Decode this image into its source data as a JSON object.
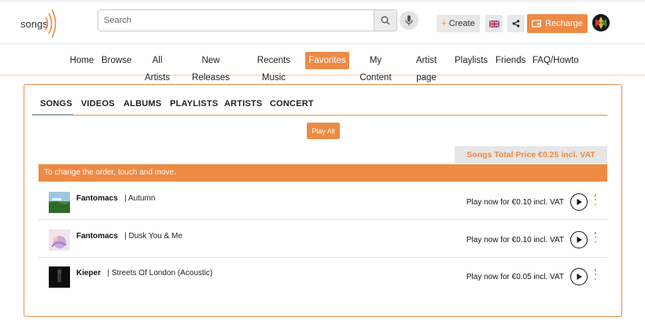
{
  "header": {
    "logo_text": "songs",
    "search": {
      "placeholder": "Search",
      "value": ""
    },
    "create_label": "Create",
    "recharge_label": "Recharge"
  },
  "nav": {
    "items": [
      {
        "label": "Home",
        "active": false
      },
      {
        "label": "Browse",
        "active": false
      },
      {
        "label": "All Artists",
        "active": false
      },
      {
        "label": "New Releases",
        "active": false
      },
      {
        "label": "Recents Music",
        "active": false
      },
      {
        "label": "Favorites",
        "active": true
      },
      {
        "label": "My Content",
        "active": false
      },
      {
        "label": "Artist page",
        "active": false
      },
      {
        "label": "Playlists",
        "active": false
      },
      {
        "label": "Friends",
        "active": false
      },
      {
        "label": "FAQ/Howto",
        "active": false
      }
    ]
  },
  "tabs": [
    {
      "label": "SONGS",
      "active": true
    },
    {
      "label": "VIDEOS",
      "active": false
    },
    {
      "label": "ALBUMS",
      "active": false
    },
    {
      "label": "PLAYLISTS",
      "active": false
    },
    {
      "label": "ARTISTS",
      "active": false
    },
    {
      "label": "CONCERT",
      "active": false
    }
  ],
  "play_all_label": "Play All",
  "total_price_label": "Songs Total Price €0.25 incl. VAT",
  "hint_text": "To change the order, touch and move.",
  "songs": [
    {
      "artist": "Fantomacs",
      "title": "| Autumn",
      "price": "Play now for €0.10 incl. VAT"
    },
    {
      "artist": "Fantomacs",
      "title": "| Dusk You & Me",
      "price": "Play now for €0.10 incl. VAT"
    },
    {
      "artist": "Kieper",
      "title": "| Streets Of London (Acoustic)",
      "price": "Play now for €0.05 incl. VAT"
    }
  ],
  "colors": {
    "accent": "#ee8a45",
    "tab_underline": "#ee8a45",
    "row_divider": "#e2e2e2"
  },
  "icons": [
    "search-icon",
    "microphone-icon",
    "uk-flag-icon",
    "share-icon",
    "wallet-icon",
    "play-icon",
    "more-vertical-icon"
  ]
}
